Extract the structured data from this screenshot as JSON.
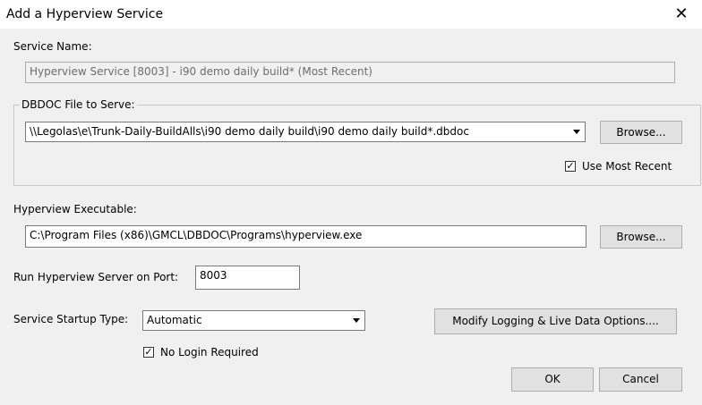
{
  "window": {
    "title": "Add a Hyperview Service",
    "close_glyph": "✕"
  },
  "service_name": {
    "label": "Service Name:",
    "value": "Hyperview Service [8003] - i90 demo daily build* (Most Recent)"
  },
  "dbdoc_group": {
    "legend": "DBDOC File to Serve:",
    "path_value": "\\\\Legolas\\e\\Trunk-Daily-BuildAlls\\i90 demo daily build\\i90 demo daily build*.dbdoc",
    "browse_label": "Browse...",
    "use_most_recent": {
      "label": "Use Most Recent",
      "checked": true
    }
  },
  "executable": {
    "label": "Hyperview Executable:",
    "value": "C:\\Program Files (x86)\\GMCL\\DBDOC\\Programs\\hyperview.exe",
    "browse_label": "Browse..."
  },
  "port": {
    "label": "Run Hyperview Server on Port:",
    "value": "8003"
  },
  "startup": {
    "label": "Service Startup Type:",
    "value": "Automatic"
  },
  "modify_button": "Modify Logging & Live Data Options....",
  "no_login": {
    "label": "No Login Required",
    "checked": true
  },
  "ok_label": "OK",
  "cancel_label": "Cancel",
  "check_glyph": "✓"
}
